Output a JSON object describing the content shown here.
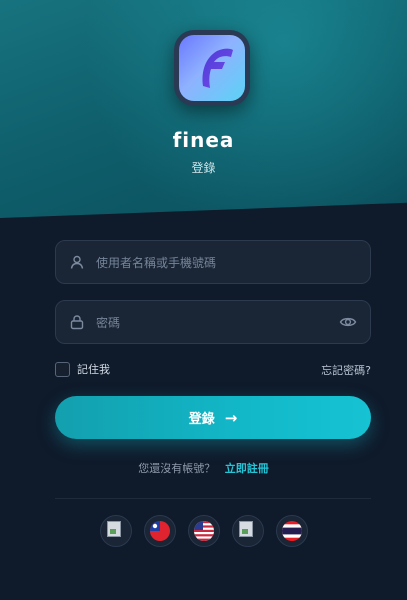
{
  "brand": {
    "name": "finea",
    "subtitle": "登錄",
    "logo_letter": "F"
  },
  "form": {
    "username_placeholder": "使用者名稱或手機號碼",
    "password_placeholder": "密碼",
    "remember_label": "記住我",
    "forgot_label": "忘記密碼?",
    "login_label": "登錄",
    "login_arrow": "→"
  },
  "signup": {
    "question": "您還沒有帳號？",
    "link": "立即註冊"
  },
  "languages": [
    {
      "icon": "broken-image-icon"
    },
    {
      "icon": "taiwan-flag-icon"
    },
    {
      "icon": "us-flag-icon"
    },
    {
      "icon": "broken-image-icon"
    },
    {
      "icon": "thailand-flag-icon"
    }
  ],
  "colors": {
    "accent": "#12b8c8",
    "background": "#0f1a2a",
    "hero": "#0f5f6c"
  }
}
